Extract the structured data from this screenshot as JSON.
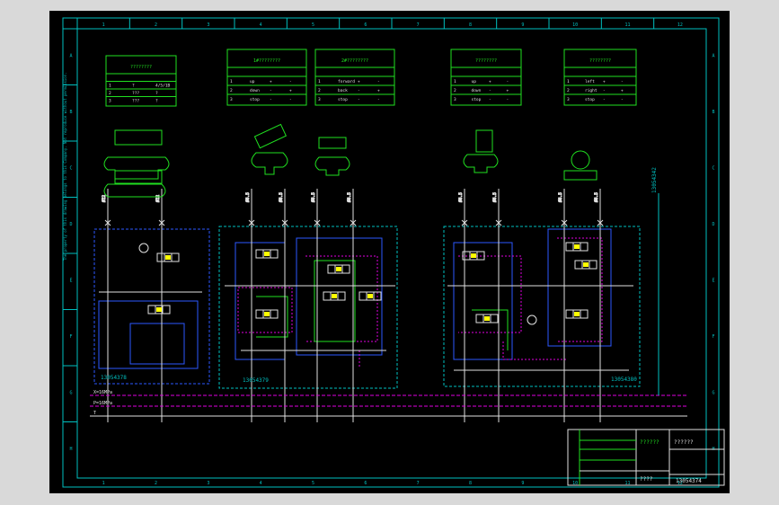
{
  "drawing": {
    "number": "13054374",
    "cols_top": [
      "1",
      "2",
      "3",
      "4",
      "5",
      "6",
      "7",
      "8",
      "9",
      "10",
      "11",
      "12"
    ],
    "rows_left": [
      "A",
      "B",
      "C",
      "D",
      "E",
      "F",
      "G",
      "H"
    ],
    "side_note": "The property of this drawing belongs to this Company. Not reproduce without permission."
  },
  "tables": [
    {
      "title": "????????",
      "rows": [
        [
          "1",
          "?",
          "4/5/1B"
        ],
        [
          "2",
          "???",
          "?"
        ],
        [
          "3",
          "???",
          "?"
        ]
      ]
    },
    {
      "title": "1#????????",
      "rows": [
        [
          "1",
          "up",
          "+",
          "-"
        ],
        [
          "2",
          "down",
          "-",
          "+"
        ],
        [
          "3",
          "stop",
          "-",
          "-"
        ]
      ]
    },
    {
      "title": "2#????????",
      "rows": [
        [
          "1",
          "forward",
          "+",
          "-"
        ],
        [
          "2",
          "back",
          "-",
          "+"
        ],
        [
          "3",
          "stop",
          "-",
          "-"
        ]
      ]
    },
    {
      "title": "????????",
      "rows": [
        [
          "1",
          "up",
          "+",
          "-"
        ],
        [
          "2",
          "down",
          "-",
          "+"
        ],
        [
          "3",
          "stop",
          "-",
          "-"
        ]
      ]
    },
    {
      "title": "????????",
      "rows": [
        [
          "1",
          "left",
          "+",
          "-"
        ],
        [
          "2",
          "right",
          "-",
          "+"
        ],
        [
          "3",
          "stop",
          "-",
          "-"
        ]
      ]
    }
  ],
  "module_labels": [
    "13054378",
    "13054379",
    "13054380"
  ],
  "pipe_labels": [
    "Ø12",
    "Ø12",
    "Ø6.5",
    "Ø6.5",
    "Ø6.5",
    "Ø6.5",
    "Ø6.5",
    "Ø6.5",
    "Ø6.5",
    "Ø6.5"
  ],
  "vertical_label": "13054342",
  "bus_labels": [
    "X=16MPa",
    "P=16MPa",
    "T"
  ],
  "title_block": {
    "company": "??????",
    "name": "??????",
    "dwg": "13054374",
    "zh": "????"
  }
}
